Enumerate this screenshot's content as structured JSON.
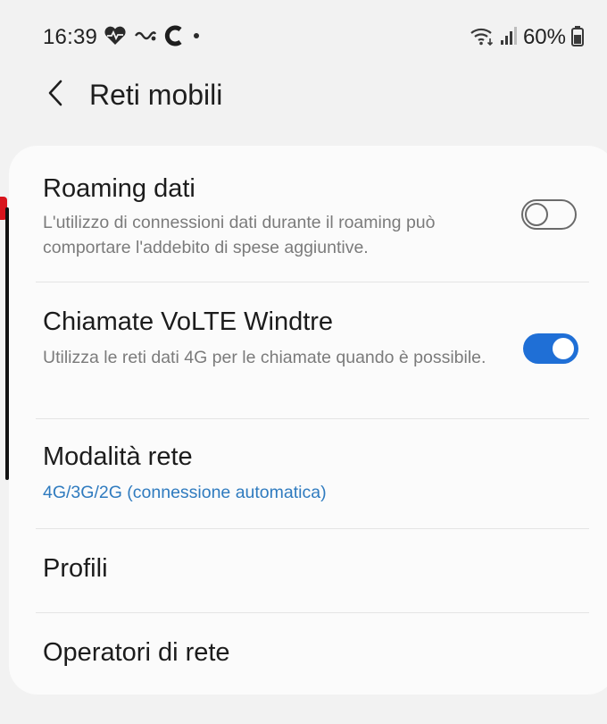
{
  "status_bar": {
    "time": "16:39",
    "battery_percent": "60%",
    "icons_left": [
      "heart-rate-icon",
      "link-icon",
      "c-app-icon",
      "dot-icon"
    ],
    "icons_right": [
      "wifi-icon",
      "signal-icon",
      "battery-icon"
    ]
  },
  "header": {
    "title": "Reti mobili",
    "back_icon": "chevron-left-icon"
  },
  "settings": {
    "items": [
      {
        "title": "Roaming dati",
        "subtitle": "L'utilizzo di connessioni dati durante il roaming può comportare l'addebito di spese aggiuntive.",
        "toggle": false
      },
      {
        "title": "Chiamate VoLTE Windtre",
        "subtitle": "Utilizza le reti dati 4G per le chiamate quando è possibile.",
        "toggle": true
      },
      {
        "title": "Modalità rete",
        "subtitle": "4G/3G/2G (connessione automatica)"
      },
      {
        "title": "Profili"
      },
      {
        "title": "Operatori di rete"
      }
    ]
  },
  "colors": {
    "background": "#f2f2f2",
    "card": "#fbfbfb",
    "accent": "#1f6fd6",
    "link_text": "#2f7bbf",
    "secondary_text": "#7b7b7b"
  }
}
